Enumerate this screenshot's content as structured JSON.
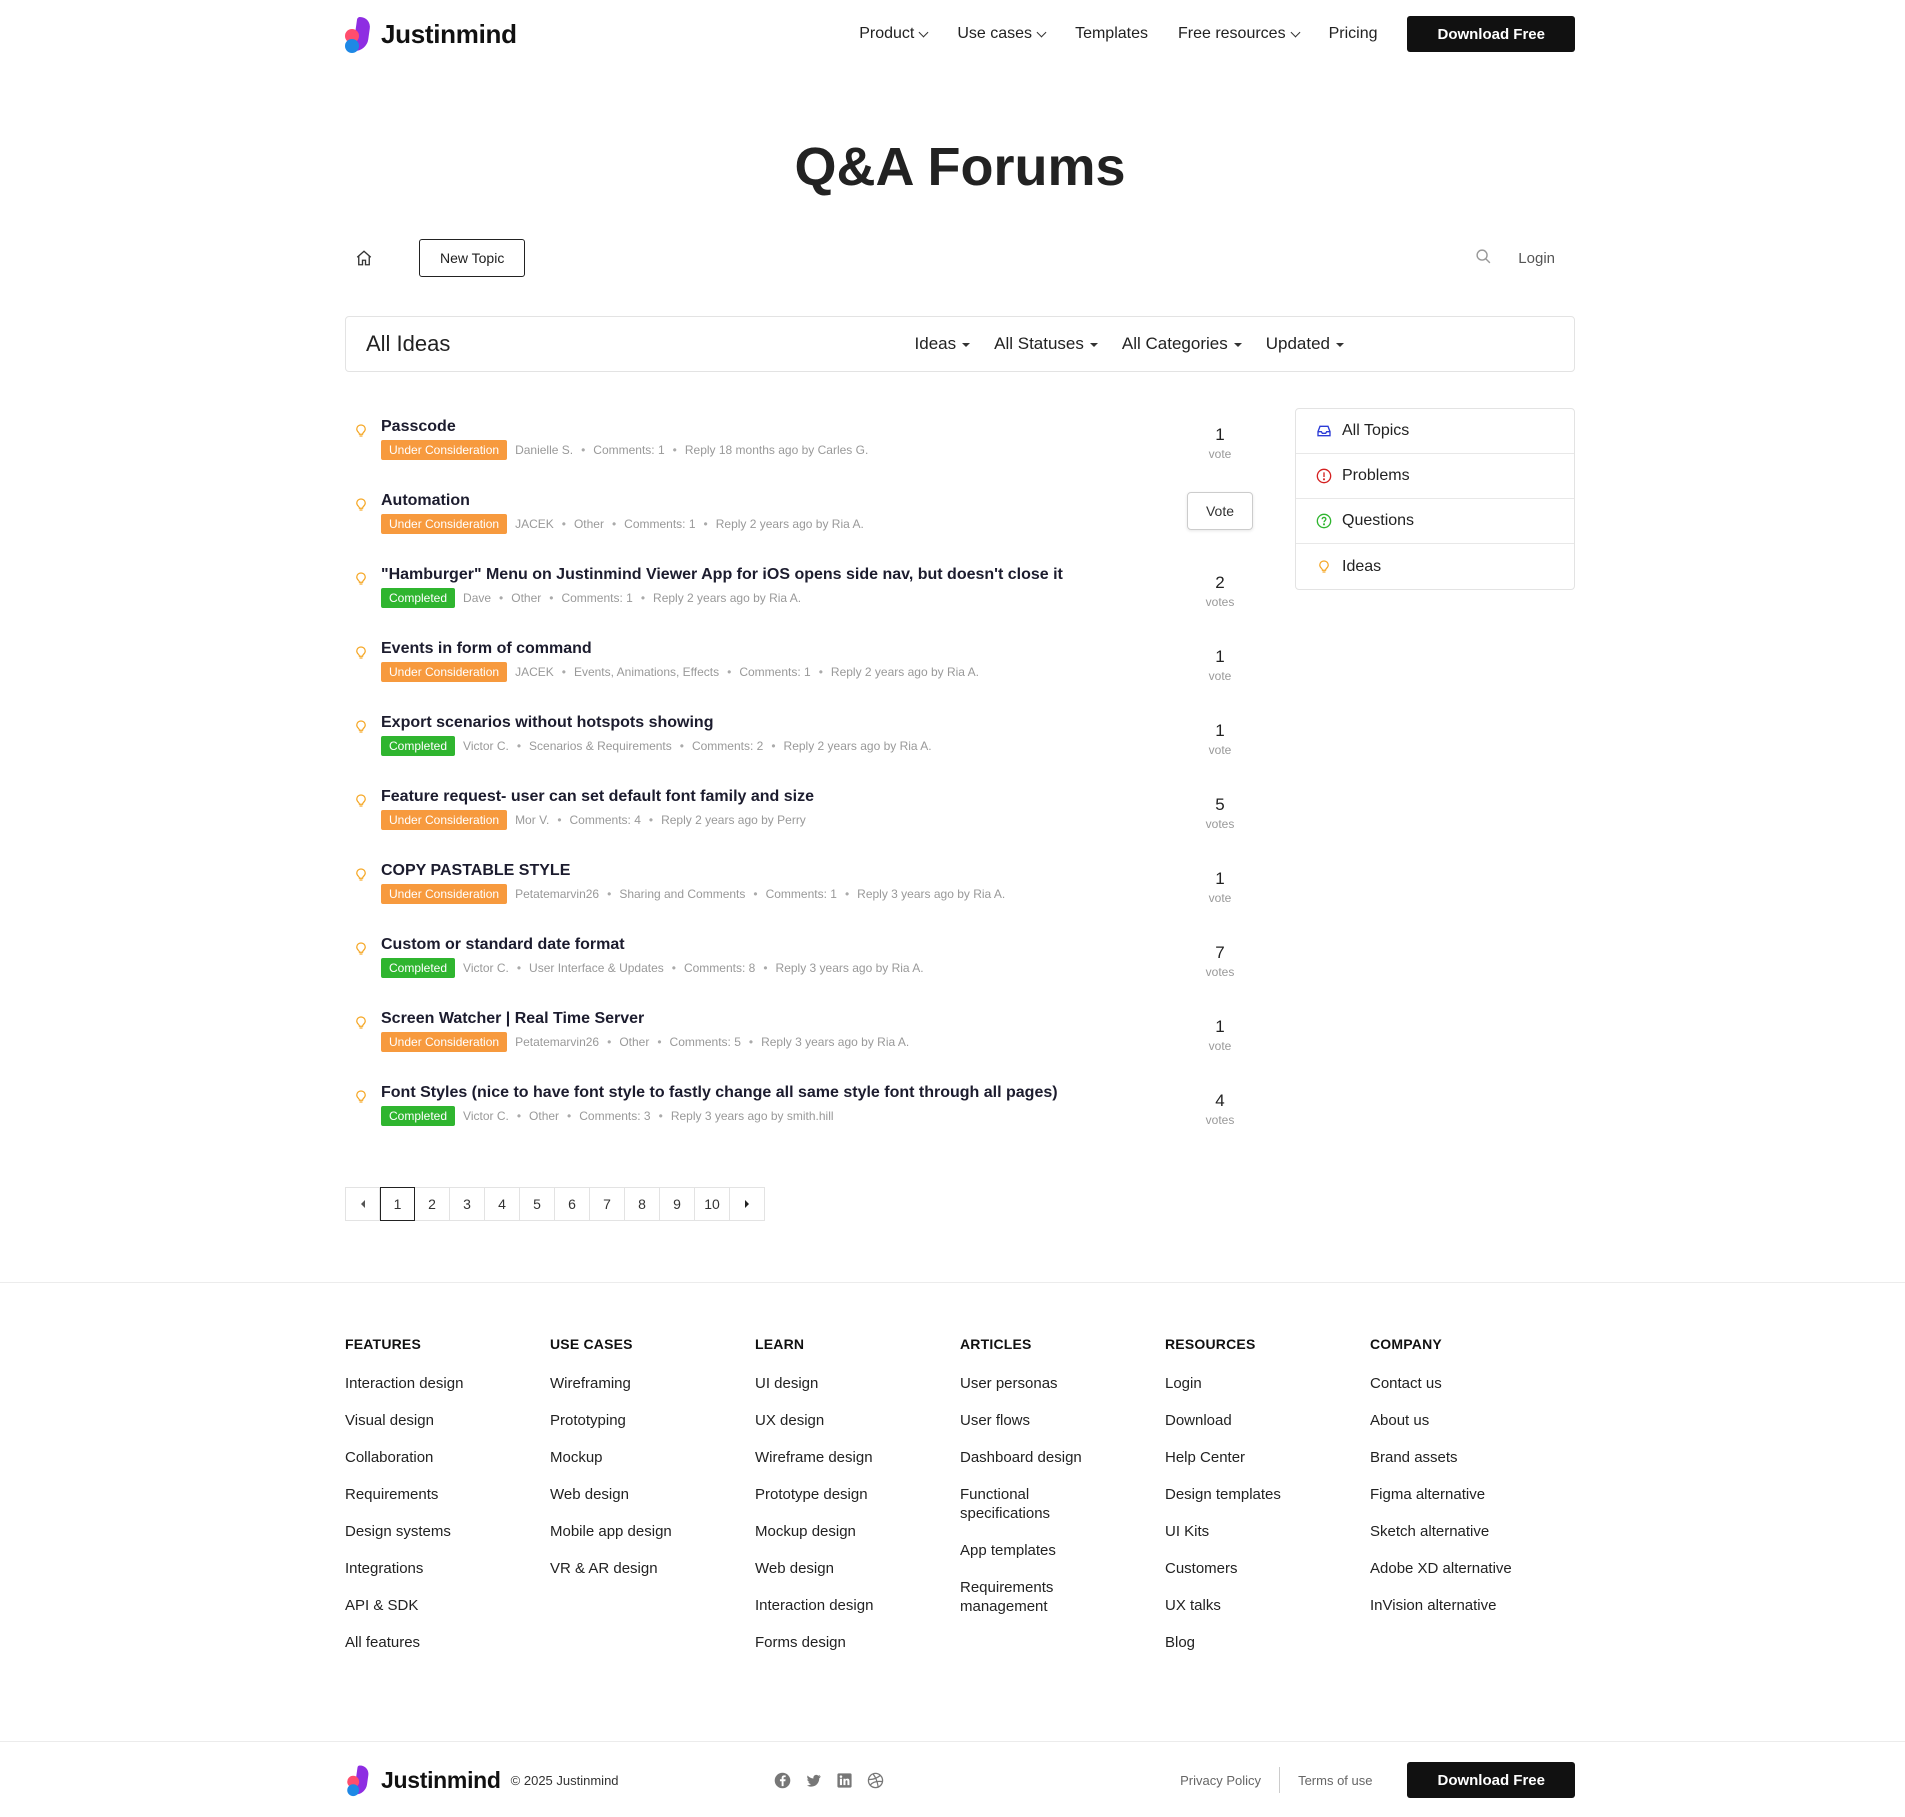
{
  "brand": {
    "name": "Justinmind"
  },
  "nav": {
    "items": [
      {
        "label": "Product",
        "dropdown": true
      },
      {
        "label": "Use cases",
        "dropdown": true
      },
      {
        "label": "Templates",
        "dropdown": false
      },
      {
        "label": "Free resources",
        "dropdown": true
      },
      {
        "label": "Pricing",
        "dropdown": false
      }
    ],
    "cta": "Download Free"
  },
  "page": {
    "title": "Q&A Forums"
  },
  "toolbar": {
    "new_topic": "New Topic",
    "login": "Login"
  },
  "filterbar": {
    "title": "All Ideas",
    "filters": [
      "Ideas",
      "All Statuses",
      "All Categories",
      "Updated"
    ]
  },
  "topics": [
    {
      "title": "Passcode",
      "status": "Under Consideration",
      "status_type": "uc",
      "meta": [
        "Danielle S.",
        "Comments: 1",
        "Reply  18 months ago by Carles G."
      ],
      "votes": "1",
      "votes_label": "vote",
      "show_vote_button": false
    },
    {
      "title": "Automation",
      "status": "Under Consideration",
      "status_type": "uc",
      "meta": [
        "JACEK",
        "Other",
        "Comments: 1",
        "Reply  2 years ago by Ria A."
      ],
      "votes": "",
      "votes_label": "",
      "show_vote_button": true,
      "vote_button": "Vote"
    },
    {
      "title": "\"Hamburger\" Menu on Justinmind Viewer App for iOS opens side nav, but doesn't close it",
      "status": "Completed",
      "status_type": "cp",
      "meta": [
        "Dave",
        "Other",
        "Comments: 1",
        "Reply  2 years ago by Ria A."
      ],
      "votes": "2",
      "votes_label": "votes",
      "show_vote_button": false
    },
    {
      "title": "Events in form of command",
      "status": "Under Consideration",
      "status_type": "uc",
      "meta": [
        "JACEK",
        "Events, Animations, Effects",
        "Comments: 1",
        "Reply  2 years ago by Ria A."
      ],
      "votes": "1",
      "votes_label": "vote",
      "show_vote_button": false
    },
    {
      "title": "Export scenarios without hotspots showing",
      "status": "Completed",
      "status_type": "cp",
      "meta": [
        "Victor C.",
        "Scenarios & Requirements",
        "Comments: 2",
        "Reply  2 years ago by Ria A."
      ],
      "votes": "1",
      "votes_label": "vote",
      "show_vote_button": false
    },
    {
      "title": "Feature request- user can set default font family and size",
      "status": "Under Consideration",
      "status_type": "uc",
      "meta": [
        "Mor V.",
        "Comments: 4",
        "Reply  2 years ago by Perry"
      ],
      "votes": "5",
      "votes_label": "votes",
      "show_vote_button": false
    },
    {
      "title": "COPY PASTABLE STYLE",
      "status": "Under Consideration",
      "status_type": "uc",
      "meta": [
        "Petatemarvin26",
        "Sharing and Comments",
        "Comments: 1",
        "Reply  3 years ago by Ria A."
      ],
      "votes": "1",
      "votes_label": "vote",
      "show_vote_button": false
    },
    {
      "title": "Custom or standard date format",
      "status": "Completed",
      "status_type": "cp",
      "meta": [
        "Victor C.",
        "User Interface & Updates",
        "Comments: 8",
        "Reply  3 years ago by Ria A."
      ],
      "votes": "7",
      "votes_label": "votes",
      "show_vote_button": false
    },
    {
      "title": "Screen Watcher | Real Time Server",
      "status": "Under Consideration",
      "status_type": "uc",
      "meta": [
        "Petatemarvin26",
        "Other",
        "Comments: 5",
        "Reply  3 years ago by Ria A."
      ],
      "votes": "1",
      "votes_label": "vote",
      "show_vote_button": false
    },
    {
      "title": "Font Styles (nice to have font style to fastly change all same style font through all pages)",
      "status": "Completed",
      "status_type": "cp",
      "meta": [
        "Victor C.",
        "Other",
        "Comments: 3",
        "Reply  3 years ago by smith.hill"
      ],
      "votes": "4",
      "votes_label": "votes",
      "show_vote_button": false
    }
  ],
  "sidebar": {
    "items": [
      {
        "label": "All Topics",
        "icon": "inbox-icon",
        "color": "#2b3bd6"
      },
      {
        "label": "Problems",
        "icon": "alert-icon",
        "color": "#d42020"
      },
      {
        "label": "Questions",
        "icon": "question-icon",
        "color": "#2fb52f"
      },
      {
        "label": "Ideas",
        "icon": "lightbulb-icon",
        "color": "#f5a623"
      }
    ]
  },
  "pagination": {
    "pages": [
      "1",
      "2",
      "3",
      "4",
      "5",
      "6",
      "7",
      "8",
      "9",
      "10"
    ],
    "current": "1"
  },
  "footer": {
    "columns": [
      {
        "heading": "FEATURES",
        "links": [
          "Interaction design",
          "Visual design",
          "Collaboration",
          "Requirements",
          "Design systems",
          "Integrations",
          "API & SDK",
          "All features"
        ]
      },
      {
        "heading": "USE CASES",
        "links": [
          "Wireframing",
          "Prototyping",
          "Mockup",
          "Web design",
          "Mobile app design",
          "VR & AR design"
        ]
      },
      {
        "heading": "LEARN",
        "links": [
          "UI design",
          "UX design",
          "Wireframe design",
          "Prototype design",
          "Mockup design",
          "Web design",
          "Interaction design",
          "Forms design"
        ]
      },
      {
        "heading": "ARTICLES",
        "links": [
          "User personas",
          "User flows",
          "Dashboard design",
          "Functional specifications",
          "App templates",
          "Requirements management"
        ]
      },
      {
        "heading": "RESOURCES",
        "links": [
          "Login",
          "Download",
          "Help Center",
          "Design templates",
          "UI Kits",
          "Customers",
          "UX talks",
          "Blog"
        ]
      },
      {
        "heading": "COMPANY",
        "links": [
          "Contact us",
          "About us",
          "Brand assets",
          "Figma alternative",
          "Sketch alternative",
          "Adobe XD alternative",
          "InVision alternative"
        ]
      }
    ],
    "copyright": "© 2025 Justinmind",
    "social": [
      "facebook-icon",
      "twitter-icon",
      "linkedin-icon",
      "dribbble-icon"
    ],
    "privacy": "Privacy Policy",
    "terms": "Terms of use",
    "cta": "Download Free"
  },
  "colors": {
    "under_consideration": "#f79a3e",
    "completed": "#2fb52f",
    "idea_icon": "#f5a623"
  }
}
